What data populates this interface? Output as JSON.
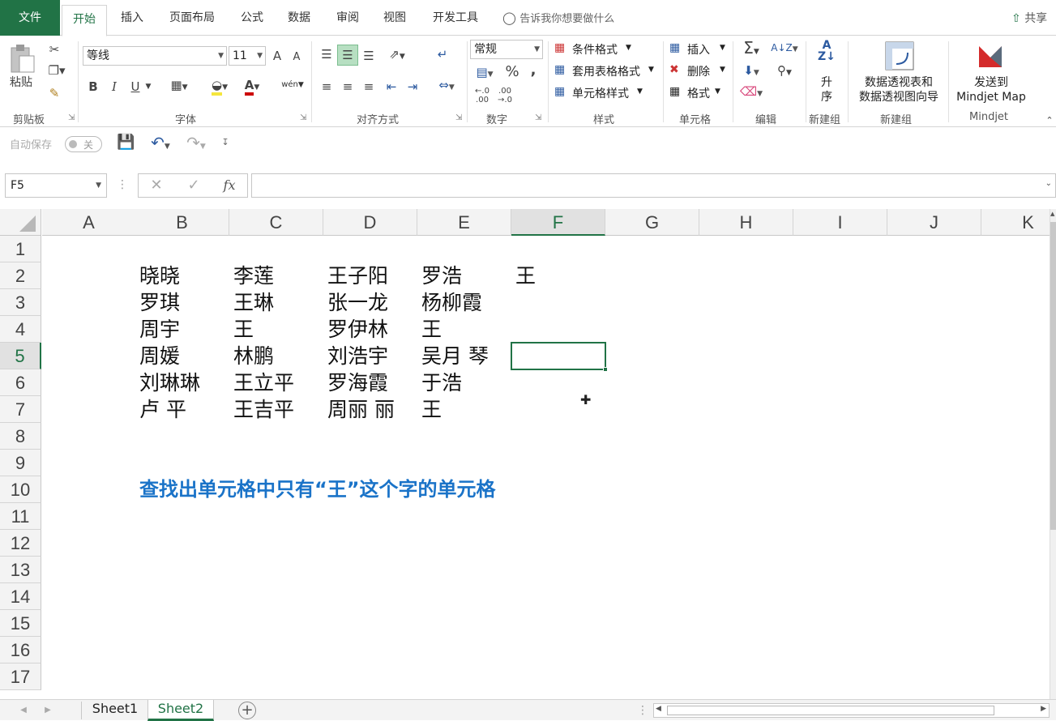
{
  "ribbon_tabs": {
    "file": "文件",
    "home": "开始",
    "insert": "插入",
    "page_layout": "页面布局",
    "formulas": "公式",
    "data": "数据",
    "review": "审阅",
    "view": "视图",
    "developer": "开发工具"
  },
  "tell_me": "告诉我你想要做什么",
  "share": "共享",
  "clipboard": {
    "paste": "粘贴",
    "label": "剪贴板"
  },
  "font": {
    "name": "等线",
    "size": "11",
    "label": "字体",
    "bold": "B",
    "italic": "I",
    "underline": "U",
    "grow": "A",
    "shrink": "A",
    "phonetic": "wén"
  },
  "alignment": {
    "label": "对齐方式"
  },
  "number": {
    "format": "常规",
    "percent": "%",
    "comma": ",",
    "label": "数字"
  },
  "styles": {
    "conditional": "条件格式",
    "table": "套用表格格式",
    "cell_styles": "单元格样式",
    "label": "样式"
  },
  "cells": {
    "insert": "插入",
    "delete": "删除",
    "format": "格式",
    "label": "单元格"
  },
  "editing": {
    "label": "编辑"
  },
  "sort": {
    "line1": "升",
    "line2": "序",
    "group": "新建组"
  },
  "pivot": {
    "line1": "数据透视表和",
    "line2": "数据透视图向导",
    "group": "新建组"
  },
  "mindjet": {
    "line1": "发送到",
    "line2": "Mindjet Map",
    "group": "Mindjet"
  },
  "qat": {
    "autosave": "自动保存",
    "toggle": "关"
  },
  "formula_bar": {
    "name_box": "F5",
    "fx": "fx",
    "value": ""
  },
  "columns": [
    "A",
    "B",
    "C",
    "D",
    "E",
    "F",
    "G",
    "H",
    "I",
    "J",
    "K"
  ],
  "selected_column": "F",
  "rows": [
    "1",
    "2",
    "3",
    "4",
    "5",
    "6",
    "7",
    "8",
    "9",
    "10",
    "11",
    "12",
    "13",
    "14",
    "15",
    "16",
    "17"
  ],
  "selected_row": "5",
  "cells_data": {
    "B2": "晓晓",
    "C2": "李莲",
    "D2": "王子阳",
    "E2": "罗浩",
    "F2": "王",
    "B3": "罗琪",
    "C3": "王琳",
    "D3": "张一龙",
    "E3": "杨柳霞",
    "B4": " 周宇",
    "C4": "王",
    "D4": "罗伊林",
    "E4": "王",
    "B5": "周媛",
    "C5": "林鹏",
    "D5": "刘浩宇",
    "E5": "吴月 琴",
    "B6": "刘琳琳",
    "C6": "王立平",
    "D6": "罗海霞",
    "E6": "于浩",
    "B7": "卢 平",
    "C7": "王吉平",
    "D7": "周丽 丽",
    "E7": "王",
    "B10": "查找出单元格中只有“王”这个字的单元格"
  },
  "sheets": [
    "Sheet1",
    "Sheet2"
  ],
  "active_sheet": "Sheet2",
  "accent_color": "#217346",
  "note_color": "#1a73c8"
}
